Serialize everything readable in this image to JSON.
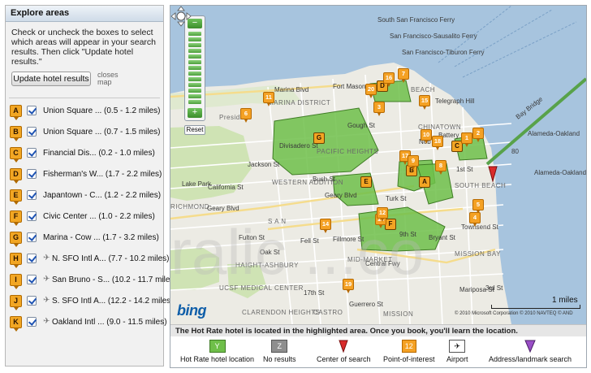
{
  "panel": {
    "title": "Explore areas",
    "instructions": "Check or uncheck the boxes to select which areas will appear in your search results. Then click \"Update hotel results.\"",
    "update_button": "Update hotel results",
    "closes_map": "closes map",
    "areas": [
      {
        "letter": "A",
        "label": "Union Square ... (0.5 - 1.2 miles)",
        "airport": false
      },
      {
        "letter": "B",
        "label": "Union Square ... (0.7 - 1.5 miles)",
        "airport": false
      },
      {
        "letter": "C",
        "label": "Financial Dis... (0.2 - 1.0 miles)",
        "airport": false
      },
      {
        "letter": "D",
        "label": "Fisherman's W... (1.7 - 2.2 miles)",
        "airport": false
      },
      {
        "letter": "E",
        "label": "Japantown - C... (1.2 - 2.2 miles)",
        "airport": false
      },
      {
        "letter": "F",
        "label": "Civic Center ... (1.0 - 2.2 miles)",
        "airport": false
      },
      {
        "letter": "G",
        "label": "Marina - Cow ... (1.7 - 3.2 miles)",
        "airport": false
      },
      {
        "letter": "H",
        "label": "N. SFO Intl A... (7.7 - 10.2 miles)",
        "airport": true
      },
      {
        "letter": "I",
        "label": "San Bruno - S... (10.2 - 11.7 miles)",
        "airport": true
      },
      {
        "letter": "J",
        "label": "S. SFO Intl A... (12.2 - 14.2 miles)",
        "airport": true
      },
      {
        "letter": "K",
        "label": "Oakland Intl ... (9.0 - 11.5 miles)",
        "airport": true
      }
    ]
  },
  "map": {
    "reset_label": "Reset",
    "zoom_minus": "−",
    "zoom_plus": "+",
    "scale_label": "1 miles",
    "logo": "bing",
    "copyright": "© 2010 Microsoft Corporation  © 2010 NAVTEQ  © AND",
    "neighborhoods": {
      "marina": "MARINA DISTRICT",
      "pacific": "PACIFIC HEIGHTS",
      "western": "WESTERN ADDITION",
      "haight": "HAIGHT-ASHBURY",
      "midmarket": "MID-MARKET",
      "southbeach": "SOUTH BEACH",
      "mission_bay": "MISSION BAY",
      "castro": "CASTRO",
      "mission": "MISSION",
      "clarendon": "CLARENDON HEIGHTS",
      "ucsf": "UCSF MEDICAL CENTER",
      "chinatown": "CHINATOWN",
      "nobhill": "Nob Hill",
      "beach": "BEACH",
      "richmond": "RICHMOND",
      "lakepark": "Lake Park",
      "fort": "Fort Mason",
      "presidio": "Presidio",
      "sansan": "S A N"
    },
    "streets": {
      "marina_blvd": "Marina Blvd",
      "bay_bridge": "Bay Bridge",
      "california": "California St",
      "jackson": "Jackson St",
      "bush": "Bush St",
      "geary": "Geary Blvd",
      "geary2": "Geary Blvd",
      "turk": "Turk St",
      "fell": "Fell St",
      "oak": "Oak St",
      "fulton": "Fulton St",
      "central": "Central Fwy",
      "seventeenth": "17th St",
      "mariposa": "Mariposa St",
      "bryant": "Bryant St",
      "first": "1st St",
      "third": "3rd St",
      "battery": "Battery St",
      "telegraph": "Telegraph Hill",
      "divisadero": "Divisadero St",
      "gough": "Gough St",
      "fillmore": "Fillmore St",
      "townsend": "Townsend St",
      "ninth": "9th St",
      "guerrero": "Guerrero St",
      "alameda1": "Alameda-Oakland",
      "alameda2": "Alameda-Oakland",
      "fwy80": "80",
      "ssf": "South San Francisco Ferry",
      "sf1": "San Francisco-Sausalito Ferry",
      "sf2": "San Francisco-Tiburon Ferry"
    },
    "watermark": "ralic ...co",
    "polygon_labels": [
      "G",
      "D",
      "C",
      "E",
      "B",
      "A",
      "F"
    ],
    "poi_numbers": [
      "20",
      "16",
      "7",
      "6",
      "11",
      "3",
      "15",
      "10",
      "18",
      "17",
      "9",
      "8",
      "1",
      "2",
      "5",
      "4",
      "14",
      "13",
      "12",
      "19"
    ]
  },
  "legend": {
    "note": "The Hot Rate hotel is located in the highlighted area. Once you book, you'll learn the location.",
    "items": [
      {
        "box": "Y",
        "label": "Hot Rate hotel location"
      },
      {
        "box": "Z",
        "label": "No results"
      },
      {
        "box": "",
        "label": "Center of search"
      },
      {
        "box": "12",
        "label": "Point-of-interest"
      },
      {
        "box": "",
        "label": "Airport"
      },
      {
        "box": "",
        "label": "Address/landmark search"
      }
    ]
  },
  "colors": {
    "hotel_area": "#6fbf4a",
    "poi": "#f4a124",
    "water": "#a7c4de",
    "land": "#ecebe4",
    "park": "#cfe3b4",
    "accent": "#1e53b3"
  }
}
